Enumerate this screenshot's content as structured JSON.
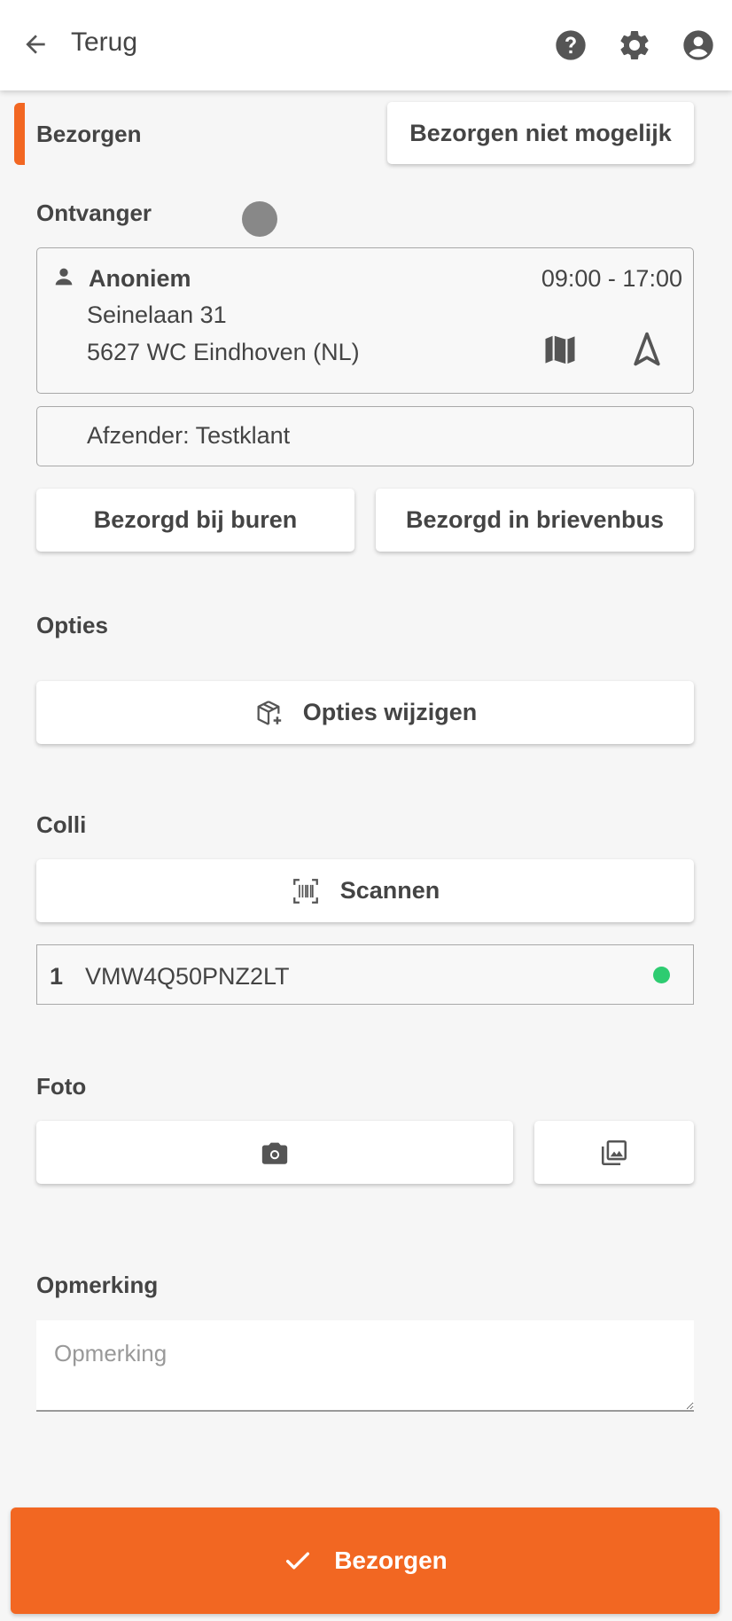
{
  "header": {
    "back_label": "Terug",
    "icons": [
      "arrow-left-icon",
      "help-icon",
      "gear-icon",
      "account-icon"
    ]
  },
  "section": {
    "title": "Bezorgen",
    "not_possible_label": "Bezorgen niet mogelijk",
    "accent_color": "#f26722"
  },
  "recipient": {
    "label": "Ontvanger",
    "name": "Anoniem",
    "time_window": "09:00 - 17:00",
    "street": "Seinelaan 31",
    "city": "5627 WC Eindhoven (NL)",
    "sender": "Afzender: Testklant"
  },
  "delivery_options": {
    "neighbours_label": "Bezorgd bij buren",
    "mailbox_label": "Bezorgd in brievenbus"
  },
  "options": {
    "label": "Opties",
    "change_label": "Opties wijzigen"
  },
  "colli": {
    "label": "Colli",
    "scan_label": "Scannen",
    "items": [
      {
        "index": "1",
        "code": "VMW4Q50PNZ2LT",
        "status_color": "#2ecc71"
      }
    ]
  },
  "photo": {
    "label": "Foto"
  },
  "remark": {
    "label": "Opmerking",
    "placeholder": "Opmerking",
    "value": ""
  },
  "submit": {
    "label": "Bezorgen"
  }
}
